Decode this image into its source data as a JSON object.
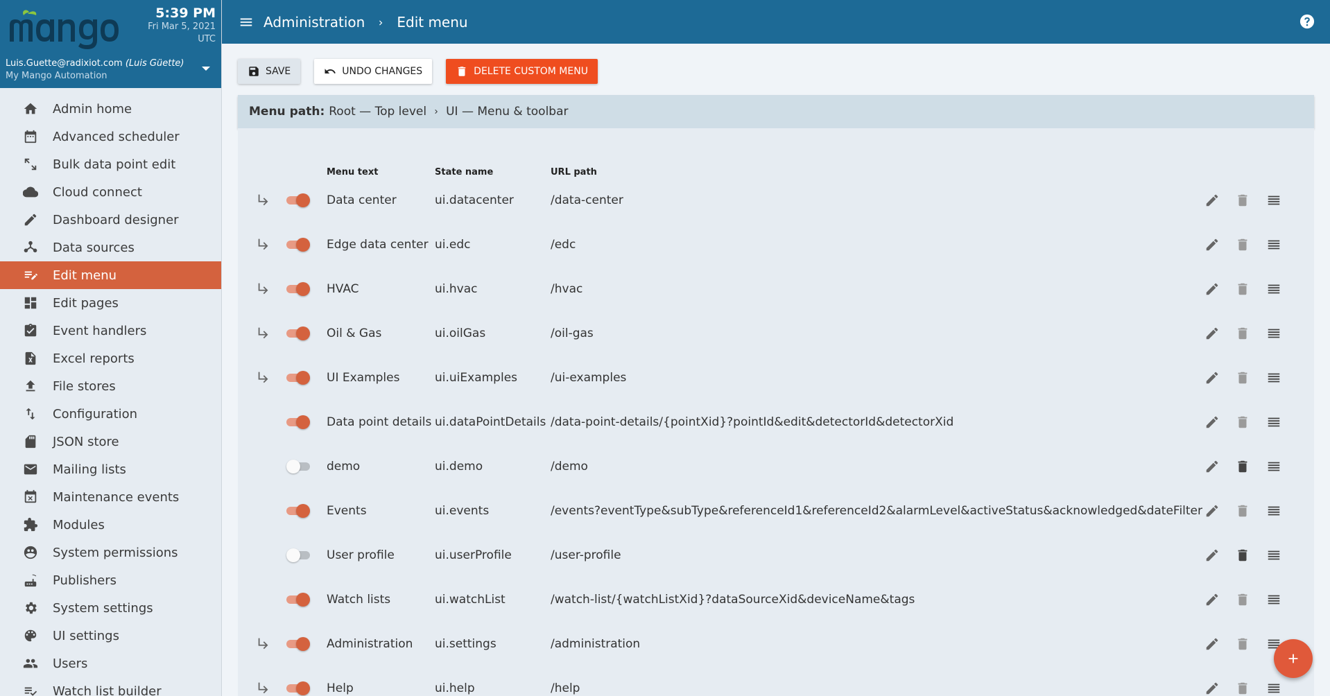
{
  "sidebar": {
    "time": "5:39 PM",
    "date": "Fri Mar 5, 2021",
    "timezone": "UTC",
    "user_email": "Luis.Guette@radixiot.com",
    "user_name": "(Luis Güette)",
    "system_name": "My Mango Automation",
    "items": [
      {
        "label": "Admin home",
        "icon": "home-icon"
      },
      {
        "label": "Advanced scheduler",
        "icon": "calendar-icon"
      },
      {
        "label": "Bulk data point edit",
        "icon": "resize-arrows-icon"
      },
      {
        "label": "Cloud connect",
        "icon": "cloud-icon"
      },
      {
        "label": "Dashboard designer",
        "icon": "pencil-icon"
      },
      {
        "label": "Data sources",
        "icon": "hub-icon"
      },
      {
        "label": "Edit menu",
        "icon": "edit-list-icon",
        "active": true
      },
      {
        "label": "Edit pages",
        "icon": "dashboard-icon"
      },
      {
        "label": "Event handlers",
        "icon": "assignment-check-icon"
      },
      {
        "label": "Excel reports",
        "icon": "excel-file-icon"
      },
      {
        "label": "File stores",
        "icon": "upload-icon"
      },
      {
        "label": "Configuration",
        "icon": "import-export-icon"
      },
      {
        "label": "JSON store",
        "icon": "sd-card-icon"
      },
      {
        "label": "Mailing lists",
        "icon": "mail-icon"
      },
      {
        "label": "Maintenance events",
        "icon": "event-busy-icon"
      },
      {
        "label": "Modules",
        "icon": "puzzle-icon"
      },
      {
        "label": "System permissions",
        "icon": "globe-lock-icon"
      },
      {
        "label": "Publishers",
        "icon": "router-icon"
      },
      {
        "label": "System settings",
        "icon": "gear-icon"
      },
      {
        "label": "UI settings",
        "icon": "palette-icon"
      },
      {
        "label": "Users",
        "icon": "people-icon"
      },
      {
        "label": "Watch list builder",
        "icon": "playlist-check-icon"
      }
    ]
  },
  "topbar": {
    "crumb_root": "Administration",
    "crumb_current": "Edit menu"
  },
  "toolbar": {
    "save_label": "SAVE",
    "undo_label": "UNDO CHANGES",
    "delete_label": "DELETE CUSTOM MENU"
  },
  "menu_path": {
    "label": "Menu path:",
    "parent": "Root — Top level",
    "current": "UI — Menu & toolbar"
  },
  "table": {
    "col_text": "Menu text",
    "col_state": "State name",
    "col_url": "URL path",
    "rows": [
      {
        "text": "Data center",
        "state": "ui.datacenter",
        "url": "/data-center",
        "enabled": true,
        "has_children": true
      },
      {
        "text": "Edge data center",
        "state": "ui.edc",
        "url": "/edc",
        "enabled": true,
        "has_children": true
      },
      {
        "text": "HVAC",
        "state": "ui.hvac",
        "url": "/hvac",
        "enabled": true,
        "has_children": true
      },
      {
        "text": "Oil & Gas",
        "state": "ui.oilGas",
        "url": "/oil-gas",
        "enabled": true,
        "has_children": true
      },
      {
        "text": "UI Examples",
        "state": "ui.uiExamples",
        "url": "/ui-examples",
        "enabled": true,
        "has_children": true
      },
      {
        "text": "Data point details",
        "state": "ui.dataPointDetails",
        "url": "/data-point-details/{pointXid}?pointId&edit&detectorId&detectorXid",
        "enabled": true,
        "has_children": false
      },
      {
        "text": "demo",
        "state": "ui.demo",
        "url": "/demo",
        "enabled": false,
        "has_children": false
      },
      {
        "text": "Events",
        "state": "ui.events",
        "url": "/events?eventType&subType&referenceId1&referenceId2&alarmLevel&activeStatus&acknowledged&dateFilter",
        "enabled": true,
        "has_children": false
      },
      {
        "text": "User profile",
        "state": "ui.userProfile",
        "url": "/user-profile",
        "enabled": false,
        "has_children": false
      },
      {
        "text": "Watch lists",
        "state": "ui.watchList",
        "url": "/watch-list/{watchListXid}?dataSourceXid&deviceName&tags",
        "enabled": true,
        "has_children": false
      },
      {
        "text": "Administration",
        "state": "ui.settings",
        "url": "/administration",
        "enabled": true,
        "has_children": true
      },
      {
        "text": "Help",
        "state": "ui.help",
        "url": "/help",
        "enabled": true,
        "has_children": true
      }
    ]
  },
  "colors": {
    "brand_blue": "#1d6a96",
    "accent_orange": "#d4623e",
    "delete_red": "#ef4d1f"
  }
}
